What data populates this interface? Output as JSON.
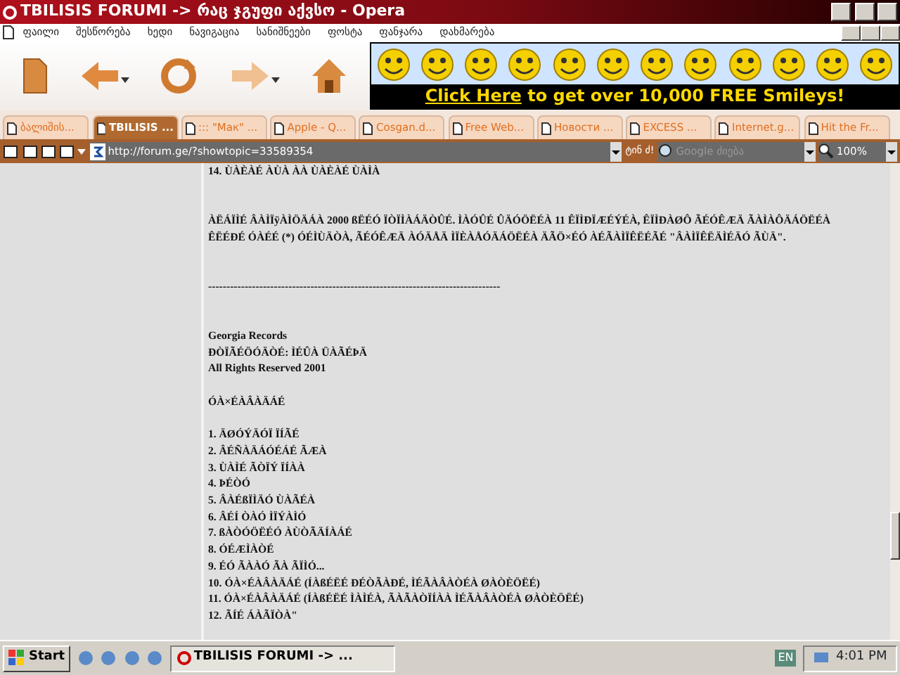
{
  "window": {
    "title": "TBILISIS FORUMI -> რაც ჯგუფი აქვსო - Opera"
  },
  "menu": [
    "ფაილი",
    "შესწორება",
    "ხედი",
    "ნავიგაცია",
    "სანიშნეები",
    "ფოსტა",
    "ფანჯარა",
    "დახმარება"
  ],
  "banner": {
    "link": "Click Here",
    "text": " to get over 10,000 FREE Smileys!"
  },
  "tabs": [
    {
      "label": "ბალიშის...",
      "selected": false
    },
    {
      "label": "TBILISIS ...",
      "selected": true
    },
    {
      "label": "::: \"Мак\" ...",
      "selected": false
    },
    {
      "label": "Apple - Q...",
      "selected": false
    },
    {
      "label": "Cosgan.d...",
      "selected": false
    },
    {
      "label": "Free Web...",
      "selected": false
    },
    {
      "label": "Новости ...",
      "selected": false
    },
    {
      "label": "EXCESS ...",
      "selected": false
    },
    {
      "label": "Internet.g...",
      "selected": false
    },
    {
      "label": "Hit the Fr...",
      "selected": false
    }
  ],
  "address": {
    "url": "http://forum.ge/?showtopic=33589354",
    "go": "ტინ ძ!",
    "search_placeholder": "Google ძიება",
    "zoom": "100%"
  },
  "content": [
    {
      "kind": "line",
      "text": "14. ÙÀÈÀÉ ÀÙÀ ÀÀ ÙÀÈÀÉ ÙÀÌÀ"
    },
    {
      "kind": "gap"
    },
    {
      "kind": "para",
      "text": "ÀËÁÏÌÉ ÂÀÌÏÿÀÌÖÄÁÀ 2000 ßËÉÓ ÏÒÏÌÀÁÄÒÛÉ. ÌÀÓÛÉ ÛÄÓÖËÉÀ 11 ÊÏÌÐÏÆÉÝÉÀ, ÊÏÌÐÀØÔ ÃÉÓÊÆÄ ÃÀÌÀÔÄÁÖËÉÀ ÊËÉÐÉ ÓÀÉÉ (*) ÓÉÌÙÄÒÀ, ÃÉÓÊÆÄ ÀÓÄÅÄ ÌÏÈÀÅÓÄÁÖËÉÀ ÄÃÖ×ÉÓ ÀÉÃÀÌÏÊËÉÃÉ \"ÂÀÌÏÊËÄÌÉÄÓ ÃÙÄ\"."
    },
    {
      "kind": "gap"
    },
    {
      "kind": "line",
      "text": "--------------------------------------------------------------------------------"
    },
    {
      "kind": "gap"
    },
    {
      "kind": "line",
      "text": "Georgia Records"
    },
    {
      "kind": "line",
      "text": "ÐÒÏÃÉÖÓÄÒÉ: ÌÉÛÀ ÜÀÃÉÞÄ"
    },
    {
      "kind": "line",
      "text": "All Rights Reserved 2001"
    },
    {
      "kind": "blank"
    },
    {
      "kind": "line",
      "text": "ÓÀ×ÉÀÂÀÄÁÉ"
    },
    {
      "kind": "blank"
    },
    {
      "kind": "line",
      "text": "1. ÄØÓÝÄÓÏ ÏÍÃÉ"
    },
    {
      "kind": "line",
      "text": "2. ÂÉÑÀÄÁÓÉÁÉ ÃÆÀ"
    },
    {
      "kind": "line",
      "text": "3. ÙÀÌÉ ÃÒÏÝ ÏÍÀÀ"
    },
    {
      "kind": "line",
      "text": "4. ÞÉÒÓ"
    },
    {
      "kind": "line",
      "text": "5. ÂÀÉßÏÌÄÓ ÙÀÃÉÀ"
    },
    {
      "kind": "line",
      "text": "6. ÂÉÍ ÒÀÓ ÌÏÝÀÌÓ"
    },
    {
      "kind": "line",
      "text": "7. ßÀÒÓÖËÉÓ ÀÙÒÃÄÍÀÁÉ"
    },
    {
      "kind": "line",
      "text": "8. ÓÉÆÌÀÒÉ"
    },
    {
      "kind": "line",
      "text": "9. ÉÓ ÃÀÀÓ ÃÀ ÃÏÌÓ..."
    },
    {
      "kind": "line",
      "text": "10. ÓÀ×ÉÀÂÀÄÁÉ (ÍÀßÉËÉ ÐÉÒÃÀÐÉ, ÌÉÃÀÂÀÒÉÀ ØÀÒÈÖËÉ)"
    },
    {
      "kind": "line",
      "text": "11. ÓÀ×ÉÀÂÀÄÁÉ (ÍÀßÉËÉ ÌÀÌÉÀ, ÃÀÃÀÒÏÍÀÀ ÌÉÃÀÂÀÒÉÀ ØÀÒÈÖËÉ)"
    },
    {
      "kind": "line",
      "text": "12. ÃÍÉ ÁÀÃÏÒÀ\""
    }
  ],
  "taskbar": {
    "start": "Start",
    "task": "TBILISIS FORUMI -> ...",
    "lang": "EN",
    "clock": "4:01 PM"
  }
}
